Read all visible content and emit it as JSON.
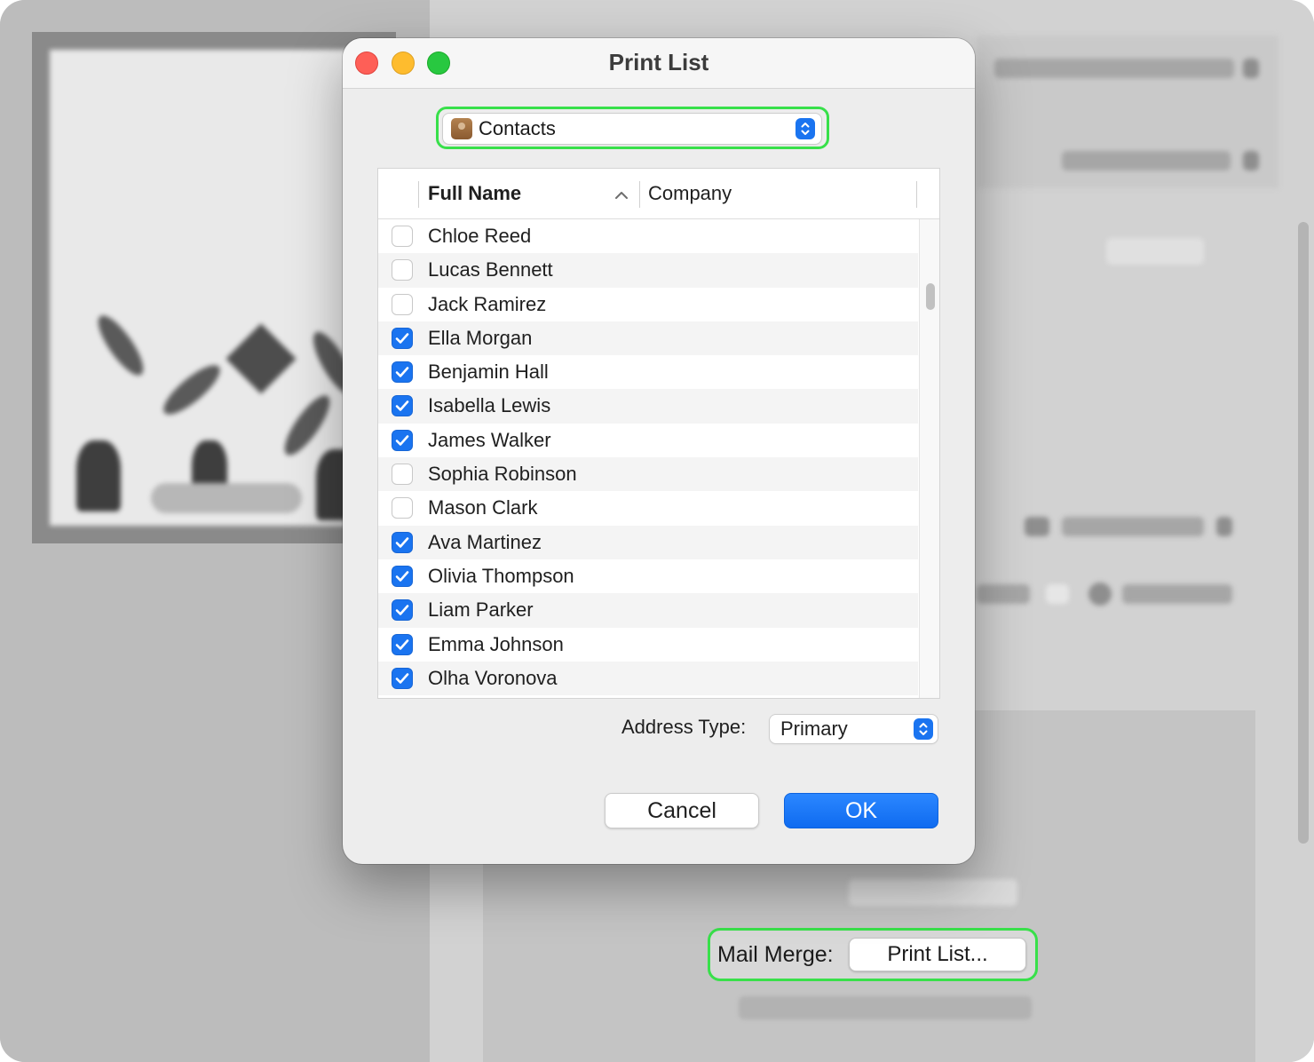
{
  "dialog": {
    "title": "Print List",
    "source": {
      "label": "Contacts",
      "icon": "contacts-icon"
    },
    "table": {
      "columns": [
        {
          "label": "Full Name",
          "sorted": "ascending"
        },
        {
          "label": "Company"
        }
      ],
      "rows": [
        {
          "name": "Chloe Reed",
          "checked": false
        },
        {
          "name": "Lucas Bennett",
          "checked": false
        },
        {
          "name": "Jack Ramirez",
          "checked": false
        },
        {
          "name": "Ella Morgan",
          "checked": true
        },
        {
          "name": "Benjamin Hall",
          "checked": true
        },
        {
          "name": "Isabella Lewis",
          "checked": true
        },
        {
          "name": "James Walker",
          "checked": true
        },
        {
          "name": "Sophia Robinson",
          "checked": false
        },
        {
          "name": "Mason Clark",
          "checked": false
        },
        {
          "name": "Ava Martinez",
          "checked": true
        },
        {
          "name": "Olivia Thompson",
          "checked": true
        },
        {
          "name": "Liam Parker",
          "checked": true
        },
        {
          "name": "Emma Johnson",
          "checked": true
        },
        {
          "name": "Olha Voronova",
          "checked": true
        }
      ]
    },
    "address_type": {
      "label": "Address Type:",
      "value": "Primary"
    },
    "buttons": {
      "cancel": "Cancel",
      "ok": "OK"
    }
  },
  "background": {
    "mail_merge": {
      "label": "Mail Merge:",
      "button": "Print List..."
    }
  },
  "colors": {
    "accent": "#1a74f0",
    "highlight": "#38e04a",
    "close": "#fe5f57",
    "minimize": "#febc2e",
    "zoom": "#28c840"
  }
}
